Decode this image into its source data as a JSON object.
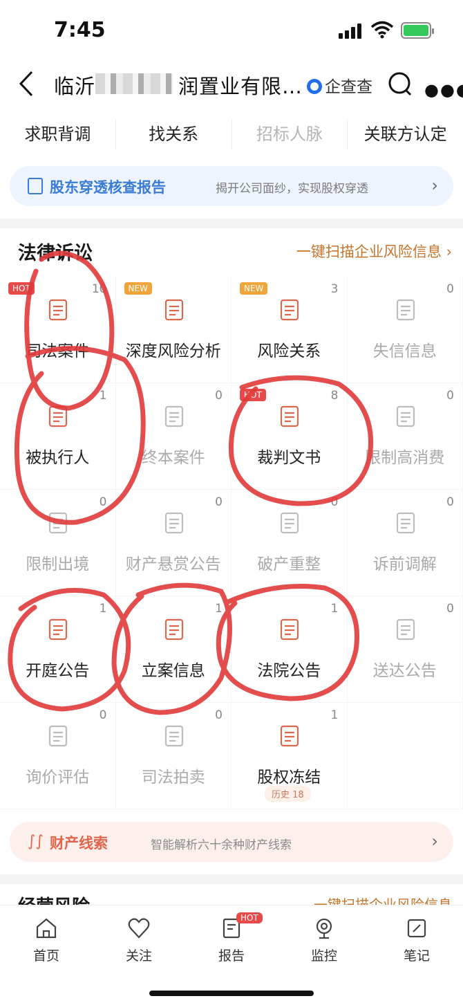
{
  "status_bar": {
    "time": "7:45"
  },
  "header": {
    "title_start": "临沂",
    "title_end": "润置业有限…",
    "brand": "企查查"
  },
  "top_tabs": [
    "求职背调",
    "找关系",
    "招标人脉",
    "关联方认定"
  ],
  "banner_equity": {
    "title": "股东穿透核查报告",
    "subtitle": "揭开公司面纱，实现股权穿透"
  },
  "legal": {
    "title": "法律诉讼",
    "link": "一键扫描企业风险信息",
    "items": [
      {
        "label": "司法案件",
        "count": "10",
        "badge": "HOT",
        "icon": "book-icon"
      },
      {
        "label": "深度风险分析",
        "count": "",
        "badge": "NEW",
        "icon": "radar-icon"
      },
      {
        "label": "风险关系",
        "count": "3",
        "badge": "NEW",
        "icon": "relation-icon"
      },
      {
        "label": "失信信息",
        "count": "0",
        "badge": "",
        "icon": "broken-heart-icon"
      },
      {
        "label": "被执行人",
        "count": "1",
        "badge": "",
        "icon": "person-icon"
      },
      {
        "label": "终本案件",
        "count": "0",
        "badge": "",
        "icon": "document-star-icon"
      },
      {
        "label": "裁判文书",
        "count": "8",
        "badge": "HOT",
        "icon": "gavel-icon"
      },
      {
        "label": "限制高消费",
        "count": "0",
        "badge": "",
        "icon": "yen-clipboard-icon"
      },
      {
        "label": "限制出境",
        "count": "0",
        "badge": "",
        "icon": "card-icon"
      },
      {
        "label": "财产悬赏公告",
        "count": "0",
        "badge": "",
        "icon": "target-yen-icon"
      },
      {
        "label": "破产重整",
        "count": "0",
        "badge": "",
        "icon": "building-doc-icon"
      },
      {
        "label": "诉前调解",
        "count": "0",
        "badge": "",
        "icon": "mail-doc-icon"
      },
      {
        "label": "开庭公告",
        "count": "1",
        "badge": "",
        "icon": "list-doc-icon"
      },
      {
        "label": "立案信息",
        "count": "1",
        "badge": "",
        "icon": "file-box-icon"
      },
      {
        "label": "法院公告",
        "count": "1",
        "badge": "",
        "icon": "notice-icon"
      },
      {
        "label": "送达公告",
        "count": "0",
        "badge": "",
        "icon": "seal-doc-icon"
      },
      {
        "label": "询价评估",
        "count": "0",
        "badge": "",
        "icon": "shield-search-icon"
      },
      {
        "label": "司法拍卖",
        "count": "0",
        "badge": "",
        "icon": "auction-icon"
      },
      {
        "label": "股权冻结",
        "count": "1",
        "badge": "",
        "icon": "freeze-shield-icon",
        "history": "历史 18"
      }
    ]
  },
  "banner_assets": {
    "title": "财产线索",
    "subtitle": "智能解析六十余种财产线索"
  },
  "next_section": {
    "title": "经营风险",
    "link": "一键扫描企业风险信息"
  },
  "bottom_nav": [
    {
      "label": "首页",
      "icon": "home-icon"
    },
    {
      "label": "关注",
      "icon": "heart-icon"
    },
    {
      "label": "报告",
      "icon": "report-icon",
      "badge": "HOT"
    },
    {
      "label": "监控",
      "icon": "camera-icon"
    },
    {
      "label": "笔记",
      "icon": "note-icon"
    }
  ],
  "colors": {
    "accent": "#e0654a",
    "blue": "#3a7bd5",
    "annotation": "#e03a3a",
    "hot": "#e84a4a",
    "new": "#f0a53a"
  }
}
